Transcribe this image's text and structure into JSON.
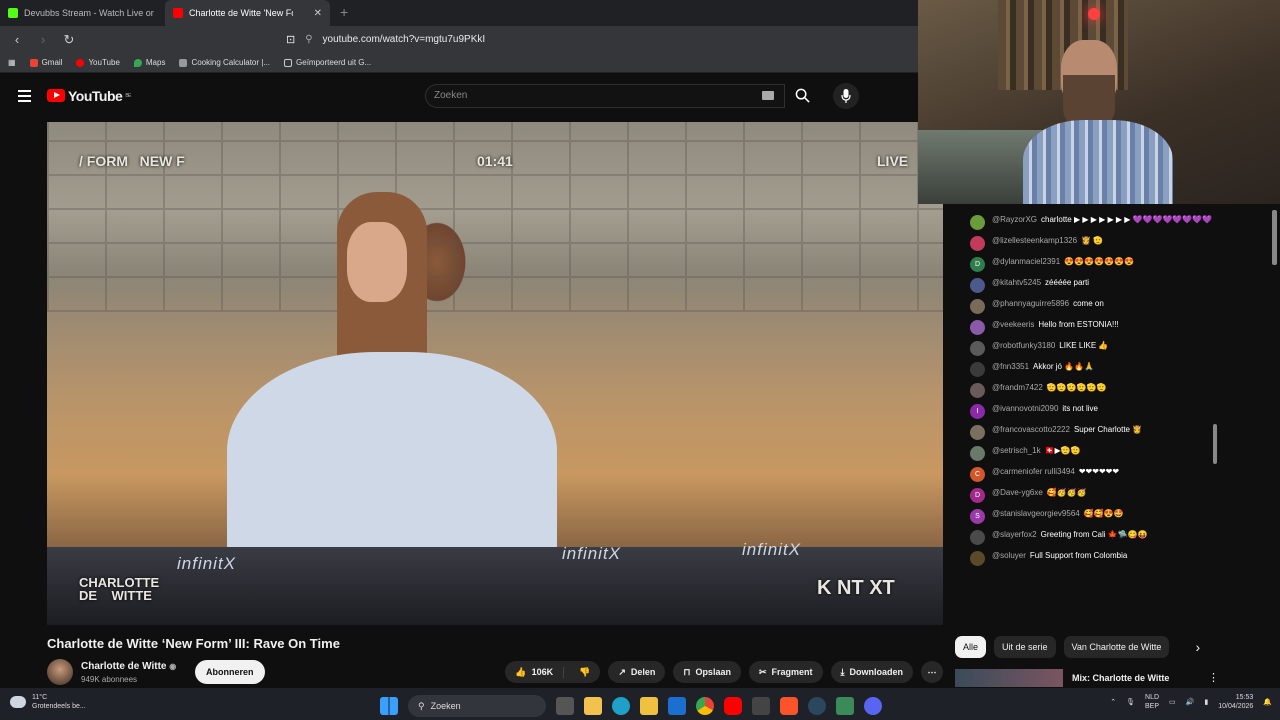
{
  "browser": {
    "tabs": [
      {
        "title": "Devubbs Stream - Watch Live on Kick",
        "color": "#53fc18"
      },
      {
        "title": "Charlotte de Witte 'New Form",
        "color": "#ff0000"
      }
    ],
    "url": "youtube.com/watch?v=mgtu7u9PKkI",
    "bookmarks": [
      "Gmail",
      "YouTube",
      "Maps",
      "Cooking Calculator |...",
      "Geïmporteerd uit G..."
    ]
  },
  "youtube": {
    "logo_text": "YouTube",
    "region": "BE",
    "search_placeholder": "Zoeken"
  },
  "video": {
    "overlay_left": "/ FORM   NEW F",
    "overlay_time": "01:41",
    "overlay_live": "LIVE",
    "overlay_brand_1": "CHARLOTTE",
    "overlay_brand_2": "DE    WITTE",
    "overlay_knt": "K NT XT",
    "deck_brand": "infinitX",
    "title": "Charlotte de Witte ‘New Form’ III: Rave On Time",
    "channel": "Charlotte de Witte",
    "subscribers": "949K abonnees",
    "subscribe_label": "Abonneren",
    "likes": "106K",
    "share_label": "Delen",
    "save_label": "Opslaan",
    "clip_label": "Fragment",
    "download_label": "Downloaden"
  },
  "chat": [
    {
      "user": "@RayzorXG",
      "text": "charlotte ▶ ▶ ▶ ▶ ▶ ▶ ▶ 💜💜💜💜💜💜💜💜",
      "avatar": "#6a9c3a",
      "initial": ""
    },
    {
      "user": "@lizellesteenkamp1326",
      "text": "👸 🫡",
      "avatar": "#c23b5a",
      "initial": ""
    },
    {
      "user": "@dylanmaciel2391",
      "text": "😍😍😍😍😍😍😍",
      "avatar": "#2f7d4a",
      "initial": "D"
    },
    {
      "user": "@kitahtv5245",
      "text": "zéééée parti",
      "avatar": "#4a5a8a",
      "initial": ""
    },
    {
      "user": "@phannyaguirre5896",
      "text": "come on",
      "avatar": "#7a6a5a",
      "initial": ""
    },
    {
      "user": "@veekeeris",
      "text": "Hello from ESTONIA!!!",
      "avatar": "#8a5aa8",
      "initial": ""
    },
    {
      "user": "@robotfunky3180",
      "text": "LIKE LIKE 👍",
      "avatar": "#5a5a5a",
      "initial": ""
    },
    {
      "user": "@fnn3351",
      "text": "Akkor jó 🔥🔥🙏",
      "avatar": "#3a3a3a",
      "initial": ""
    },
    {
      "user": "@frandm7422",
      "text": "🫡🫡🫡🫡🫡🫡",
      "avatar": "#6a5a5a",
      "initial": ""
    },
    {
      "user": "@ivannovotni2090",
      "text": "its not live",
      "avatar": "#8a2aa8",
      "initial": "I"
    },
    {
      "user": "@francovascotto2222",
      "text": "Super Charlotte 👸",
      "avatar": "#7a7060",
      "initial": ""
    },
    {
      "user": "@setrisch_1k",
      "text": "🇨🇭▶🫡🫡",
      "avatar": "#6a7a6a",
      "initial": ""
    },
    {
      "user": "@carmeniofer rulli3494",
      "text": "❤❤❤❤❤❤",
      "avatar": "#d2572a",
      "initial": "C"
    },
    {
      "user": "@Dave-yg6xe",
      "text": "🥰🥳🥳🥳",
      "avatar": "#a22a8a",
      "initial": "D"
    },
    {
      "user": "@stanislavgeorgiev9564",
      "text": "🥰🥰😍🤩",
      "avatar": "#9a3aa8",
      "initial": "S"
    },
    {
      "user": "@slayerfox2",
      "text": "Greeting from Cali 🍁🛸😋😝",
      "avatar": "#4a4a4a",
      "initial": ""
    },
    {
      "user": "@soluyer",
      "text": "Full Support from Colombia",
      "avatar": "#5a4a2a",
      "initial": ""
    }
  ],
  "chips": [
    "Alle",
    "Uit de serie",
    "Van Charlotte de Witte"
  ],
  "upnext": {
    "title": "Mix: Charlotte de Witte"
  },
  "taskbar": {
    "temp": "11°C",
    "weather": "Grotendeels be...",
    "search": "Zoeken",
    "lang_1": "NLD",
    "lang_2": "BEP",
    "time": "15:53",
    "date": "10/04/2026"
  },
  "colors": {
    "accent": "#ff0000",
    "background": "#0f0f0f"
  }
}
